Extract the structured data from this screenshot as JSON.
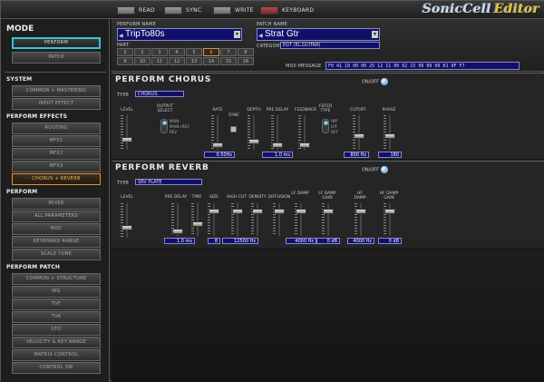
{
  "toolbar": {
    "read": "READ",
    "sync": "SYNC",
    "write": "WRITE",
    "keyboard": "KEYBOARD",
    "logo_main": "SonicCell",
    "logo_editor": "Editor"
  },
  "header": {
    "perform_name_label": "PERFORM NAME",
    "perform_name": "TripTo80s",
    "patch_name_label": "PATCH NAME",
    "patch_name": "Strat Gtr",
    "part_label": "PART",
    "parts": [
      "1",
      "2",
      "3",
      "4",
      "5",
      "6",
      "7",
      "8",
      "9",
      "10",
      "11",
      "12",
      "13",
      "14",
      "15",
      "16"
    ],
    "selected_part": "6",
    "category_label": "CATEGORY",
    "category": "EGT (EL.GUITAR)",
    "midi_label": "MIDI MESSAGE",
    "midi_message": "F0 41 10 00 00 25 12 11 00 02 15 00 00 00 01 0F F7"
  },
  "sidebar": {
    "mode_title": "MODE",
    "mode_perform": "PERFORM",
    "mode_patch": "PATCH",
    "system_title": "SYSTEM",
    "system_items": [
      "COMMON + MASTERING",
      "INPUT EFFECT"
    ],
    "effects_title": "PERFORM EFFECTS",
    "effects_items": [
      "ROUTING",
      "MFX1",
      "MFX2",
      "MFX3",
      "CHORUS + REVERB"
    ],
    "perform_title": "PERFORM",
    "perform_items": [
      "MIXER",
      "ALL PARAMETERS",
      "MIDI",
      "KEYBOARD RANGE",
      "SCALE TUNE"
    ],
    "patch_title": "PERFORM PATCH",
    "patch_items": [
      "COMMON + STRUCTURE",
      "WG",
      "TVF",
      "TVA",
      "LFO",
      "VELOCITY & KEY RANGE",
      "MATRIX CONTROL",
      "CONTROL SW"
    ]
  },
  "chorus": {
    "title": "PERFORM CHORUS",
    "onoff": "ON/OFF",
    "type_label": "TYPE",
    "type_value": "CHORUS",
    "level_label": "LEVEL",
    "output_label": "OUTPUT SELECT",
    "output_options": [
      "MAIN",
      "MAIN+REV",
      "REV"
    ],
    "rate_label": "RATE",
    "sync_label": "SYNC",
    "rate_value": "0.50Hz",
    "depth_label": "DEPTH",
    "predelay_label": "PRE DELAY",
    "predelay_value": "1.0 ms",
    "feedback_label": "FEEDBACK",
    "filter_label": "FILTER TYPE",
    "filter_options": [
      "HPF",
      "LPF",
      "OFF"
    ],
    "cutoff_label": "CUTOFF",
    "cutoff_value": "800 Hz",
    "phase_label": "PHASE",
    "phase_value": "180"
  },
  "reverb": {
    "title": "PERFORM REVERB",
    "onoff": "ON/OFF",
    "type_label": "TYPE",
    "type_value": "SRV PLATE",
    "level_label": "LEVEL",
    "predelay_label": "PRE DELAY",
    "predelay_value": "1.0 ms",
    "time_label": "TIME",
    "size_label": "SIZE",
    "size_value": "8",
    "highcut_label": "HIGH CUT",
    "highcut_value": "12500 Hz",
    "density_label": "DENSITY",
    "diffusion_label": "DIFFUSION",
    "lfdamp_label": "LF DAMP",
    "lfdamp_value": "4000 Hz",
    "lfdampgain_label": "LF DAMP GAIN",
    "lfdampgain_value": "0 dB",
    "hfdamp_label": "HF DAMP",
    "hfdamp_value": "4000 Hz",
    "hfdampgain_label": "HF DAMP GAIN",
    "hfdampgain_value": "0 dB"
  }
}
